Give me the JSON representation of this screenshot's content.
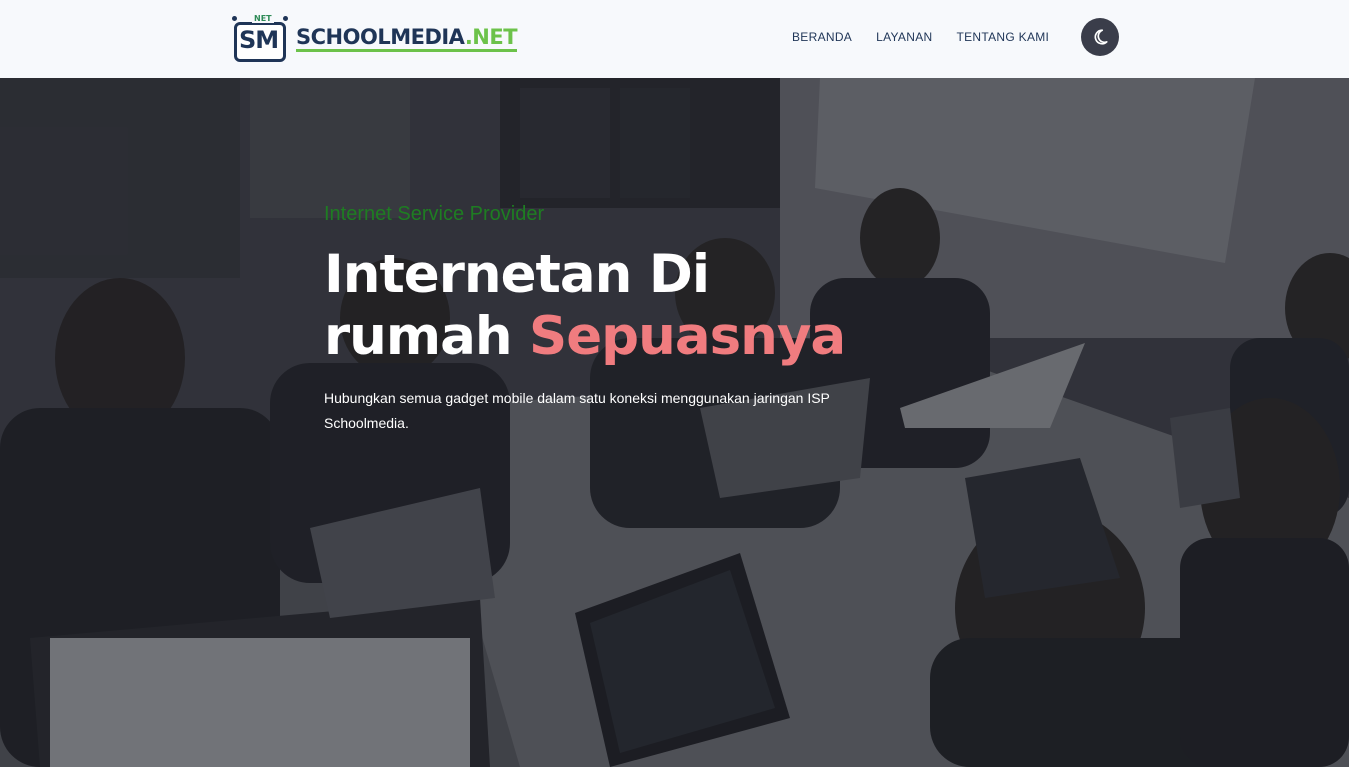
{
  "brand": {
    "logo_mark": "SM",
    "logo_mark_tag": "NET",
    "name_main": "SCHOOLMEDIA",
    "name_suffix": ".NET",
    "primary_color": "#1f3557",
    "accent_color": "#6cc24a"
  },
  "nav": {
    "items": [
      {
        "label": "BERANDA"
      },
      {
        "label": "LAYANAN"
      },
      {
        "label": "TENTANG KAMI"
      }
    ],
    "theme_toggle_icon": "moon-icon"
  },
  "hero": {
    "eyebrow": "Internet Service Provider",
    "headline_line1": "Internetan Di",
    "headline_line2_plain": "rumah ",
    "headline_line2_accent": "Sepuasnya",
    "description": "Hubungkan semua gadget mobile dalam satu koneksi menggunakan jaringan ISP Schoolmedia.",
    "accent_color": "#f07c7f",
    "eyebrow_color": "#1e7d22",
    "background": "photo of people working on laptops in a computer lab"
  }
}
